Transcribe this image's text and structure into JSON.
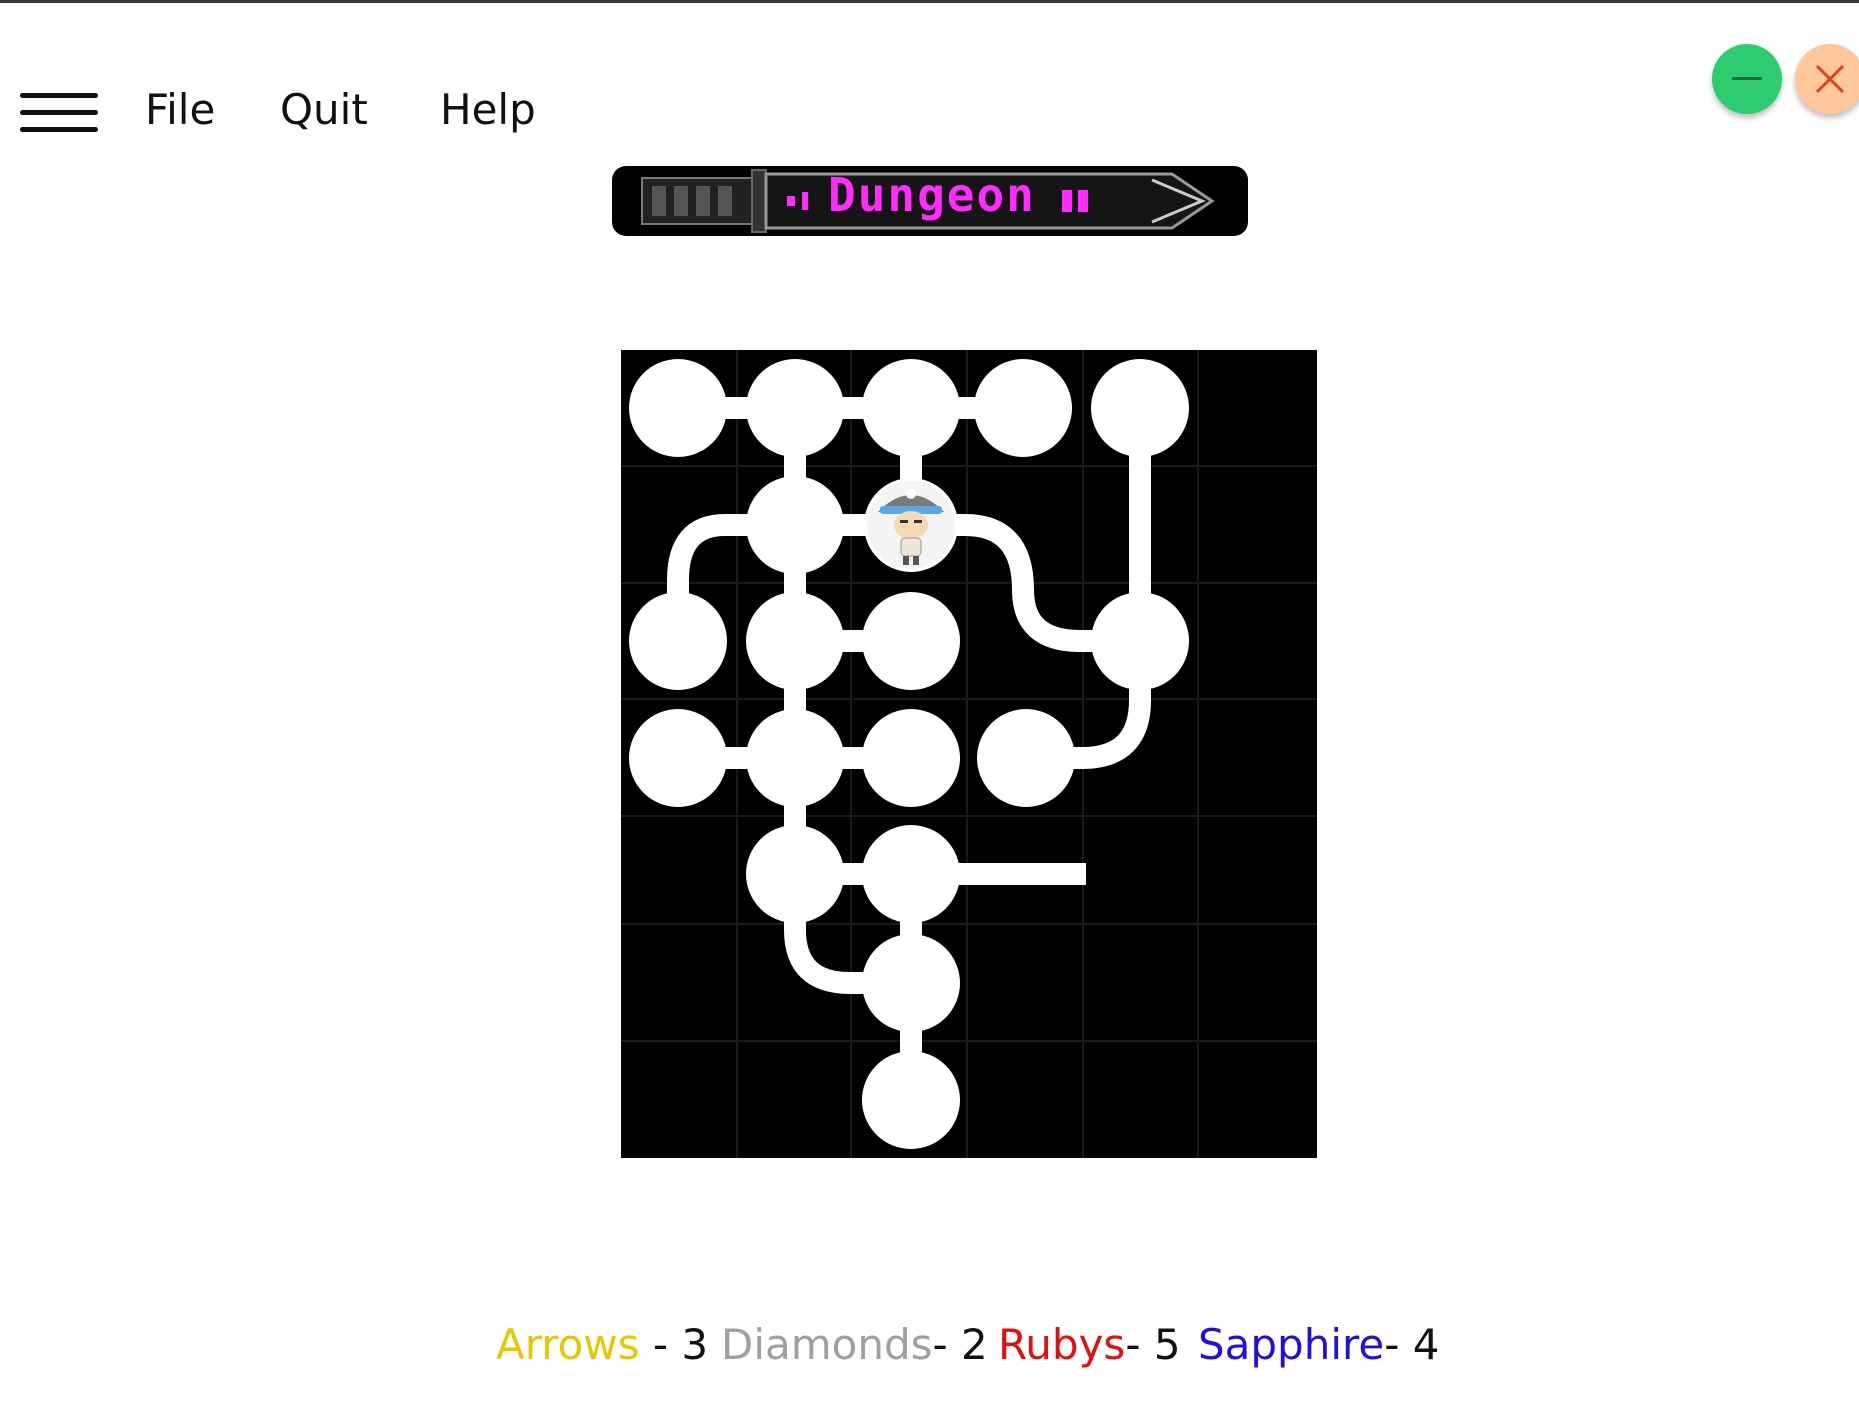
{
  "menu": {
    "items": [
      "File",
      "Quit",
      "Help"
    ]
  },
  "logo": {
    "title": "Dungeon"
  },
  "window_buttons": {
    "minimize_color": "#2ecc71",
    "close_color": "#ffc79a",
    "close_x_color": "#e04020"
  },
  "board": {
    "background": "#000000",
    "node_color": "#ffffff",
    "player_sprite": "pirate-character-icon"
  },
  "inventory": [
    {
      "label": "Arrows",
      "separator": " - ",
      "count": "3",
      "color": "#e6c800"
    },
    {
      "label": "Diamonds",
      "separator": "- ",
      "count": "2",
      "color": "#a0a0a0"
    },
    {
      "label": "Rubys",
      "separator": "- ",
      "count": "5",
      "color": "#e01010"
    },
    {
      "label": "Sapphire",
      "separator": "- ",
      "count": "4",
      "color": "#2010e0"
    }
  ]
}
